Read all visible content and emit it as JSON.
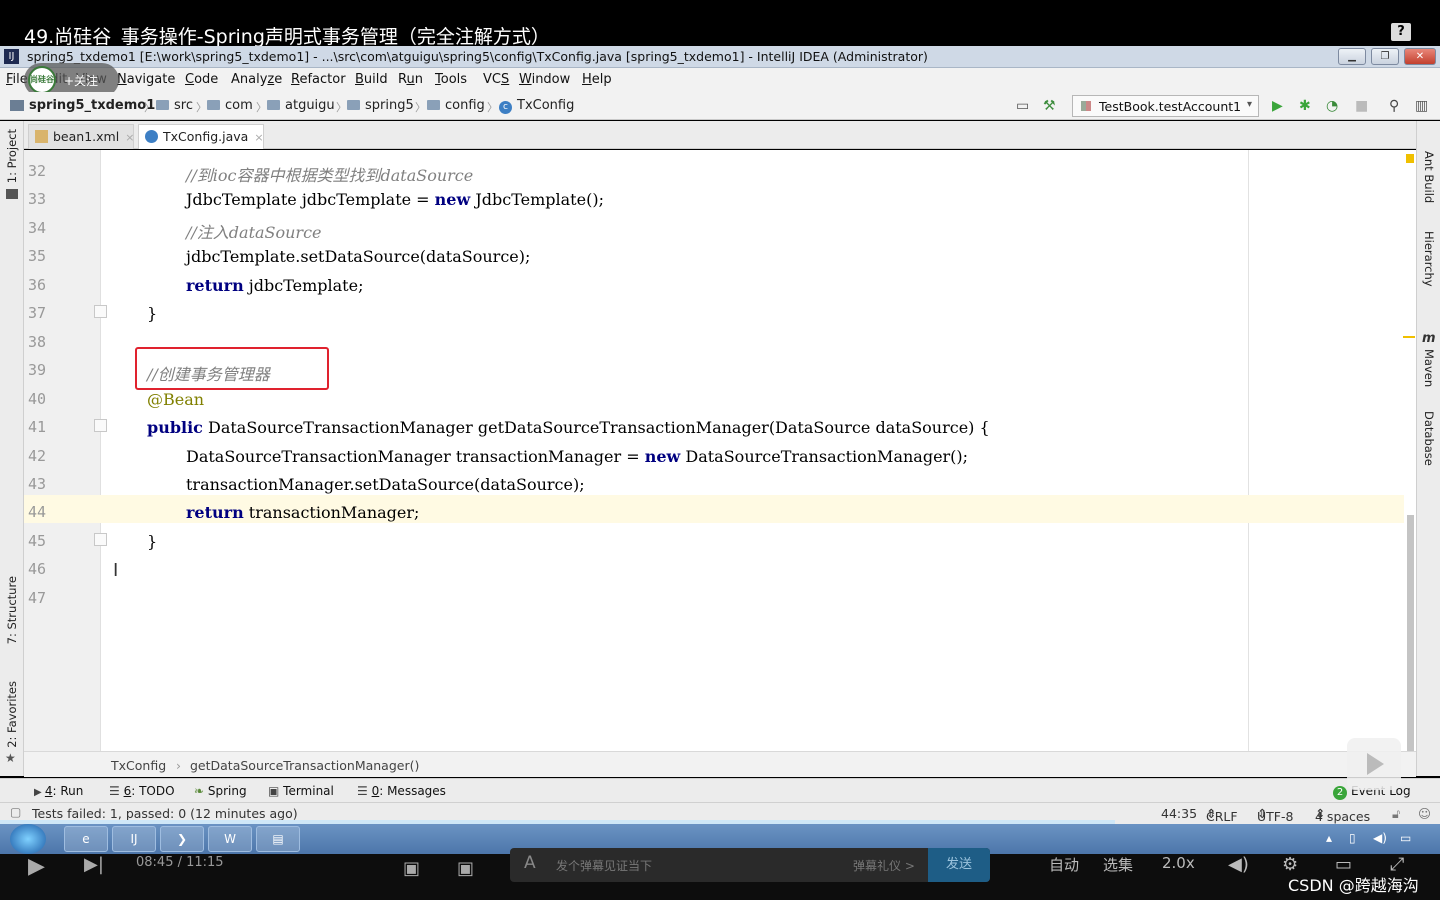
{
  "video": {
    "title": "49.尚硅谷_事务操作-Spring声明式事务管理（完全注解方式）",
    "help_label": "?"
  },
  "window": {
    "title": "spring5_txdemo1 [E:\\work\\spring5_txdemo1] - ...\\src\\com\\atguigu\\spring5\\config\\TxConfig.java [spring5_txdemo1] - IntelliJ IDEA (Administrator)",
    "app_icon": "IJ"
  },
  "overlay": {
    "logo_text": "尚硅谷",
    "label": "+关注"
  },
  "menu": [
    {
      "pre": "",
      "u": "F",
      "post": "ile"
    },
    {
      "pre": "",
      "u": "E",
      "post": "dit"
    },
    {
      "pre": "",
      "u": "V",
      "post": "iew"
    },
    {
      "pre": "",
      "u": "N",
      "post": "avigate"
    },
    {
      "pre": "",
      "u": "C",
      "post": "ode"
    },
    {
      "pre": "Analy",
      "u": "z",
      "post": "e"
    },
    {
      "pre": "",
      "u": "R",
      "post": "efactor"
    },
    {
      "pre": "",
      "u": "B",
      "post": "uild"
    },
    {
      "pre": "R",
      "u": "u",
      "post": "n"
    },
    {
      "pre": "",
      "u": "T",
      "post": "ools"
    },
    {
      "pre": "VC",
      "u": "S",
      "post": ""
    },
    {
      "pre": "",
      "u": "W",
      "post": "indow"
    },
    {
      "pre": "",
      "u": "H",
      "post": "elp"
    }
  ],
  "breadcrumb": [
    "spring5_txdemo1",
    "src",
    "com",
    "atguigu",
    "spring5",
    "config",
    "TxConfig"
  ],
  "run_config": "TestBook.testAccount1",
  "tabs": [
    {
      "label": "bean1.xml",
      "active": false
    },
    {
      "label": "TxConfig.java",
      "active": true
    }
  ],
  "left_tools": [
    "1: Project",
    "7: Structure",
    "2: Favorites"
  ],
  "right_tools": [
    "Ant Build",
    "Hierarchy",
    "Maven",
    "Database"
  ],
  "code_lines": [
    {
      "n": "32",
      "text": "//到ioc容器中根据类型找到dataSource"
    },
    {
      "n": "33",
      "text": "JdbcTemplate jdbcTemplate = new JdbcTemplate();"
    },
    {
      "n": "34",
      "text": "//注入dataSource"
    },
    {
      "n": "35",
      "text": "jdbcTemplate.setDataSource(dataSource);"
    },
    {
      "n": "36",
      "text": "return jdbcTemplate;"
    },
    {
      "n": "37",
      "text": "}"
    },
    {
      "n": "38",
      "text": ""
    },
    {
      "n": "39",
      "text": "//创建事务管理器"
    },
    {
      "n": "40",
      "text": "@Bean"
    },
    {
      "n": "41",
      "text": "public DataSourceTransactionManager getDataSourceTransactionManager(DataSource dataSource) {"
    },
    {
      "n": "42",
      "text": "DataSourceTransactionManager transactionManager = new DataSourceTransactionManager();"
    },
    {
      "n": "43",
      "text": "transactionManager.setDataSource(dataSource);"
    },
    {
      "n": "44",
      "text": "return transactionManager;"
    },
    {
      "n": "45",
      "text": "}"
    },
    {
      "n": "46",
      "text": ""
    },
    {
      "n": "47",
      "text": ""
    }
  ],
  "editor_crumb": [
    "TxConfig",
    "getDataSourceTransactionManager()"
  ],
  "tool_windows": [
    {
      "pre": "",
      "u": "4",
      "post": ": Run"
    },
    {
      "pre": "",
      "u": "6",
      "post": ": TODO"
    },
    {
      "pre": "Spring",
      "u": "",
      "post": ""
    },
    {
      "pre": "Terminal",
      "u": "",
      "post": ""
    },
    {
      "pre": "",
      "u": "0",
      "post": ": Messages"
    }
  ],
  "event_log": {
    "count": "2",
    "label": "Event Log"
  },
  "status": {
    "message": "Tests failed: 1, passed: 0 (12 minutes ago)",
    "position": "44:35",
    "line_sep": "CRLF",
    "encoding": "UTF-8",
    "indent": "4 spaces"
  },
  "player": {
    "time": "08:45 / 11:15",
    "danmu_placeholder": "发个弹幕见证当下",
    "gift": "弹幕礼仪 >",
    "send": "发送",
    "auto": "自动",
    "episodes": "选集",
    "speed": "2.0x",
    "watermark": "CSDN @跨越海沟"
  }
}
